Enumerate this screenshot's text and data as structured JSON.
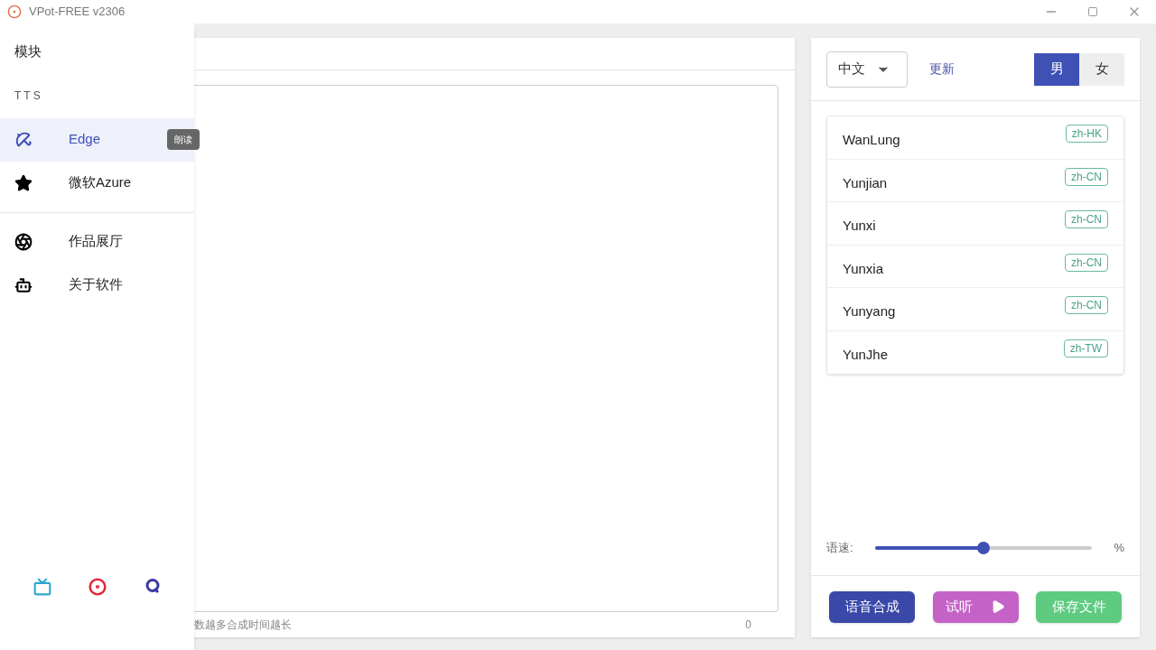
{
  "window": {
    "title": "VPot-FREE v2306"
  },
  "drawer": {
    "heading": "模块",
    "section": "TTS",
    "items": [
      {
        "label": "Edge",
        "kind": "umbrella",
        "selected": true,
        "tooltip": "朗读"
      },
      {
        "label": "微软Azure",
        "kind": "star",
        "selected": false
      }
    ],
    "more_items": [
      {
        "label": "作品展厅",
        "kind": "aperture",
        "selected": false
      },
      {
        "label": "关于软件",
        "kind": "android",
        "selected": false
      }
    ]
  },
  "editor": {
    "hint": "数越多合成时间越长",
    "count": "0"
  },
  "voices": {
    "language": "中文",
    "refresh": "更新",
    "genders": [
      {
        "label": "男",
        "selected": true
      },
      {
        "label": "女",
        "selected": false
      }
    ],
    "list": [
      {
        "name": "WanLung",
        "locale": "zh-HK"
      },
      {
        "name": "Yunjian",
        "locale": "zh-CN"
      },
      {
        "name": "Yunxi",
        "locale": "zh-CN"
      },
      {
        "name": "Yunxia",
        "locale": "zh-CN"
      },
      {
        "name": "Yunyang",
        "locale": "zh-CN"
      },
      {
        "name": "YunJhe",
        "locale": "zh-TW"
      }
    ]
  },
  "speed": {
    "label": "语速:",
    "level": 0.5,
    "unit": "%"
  },
  "actions": [
    {
      "label": "语音合成",
      "kind": "synthesize"
    },
    {
      "label": "试听",
      "kind": "preview"
    },
    {
      "label": "保存文件",
      "kind": "save"
    }
  ]
}
